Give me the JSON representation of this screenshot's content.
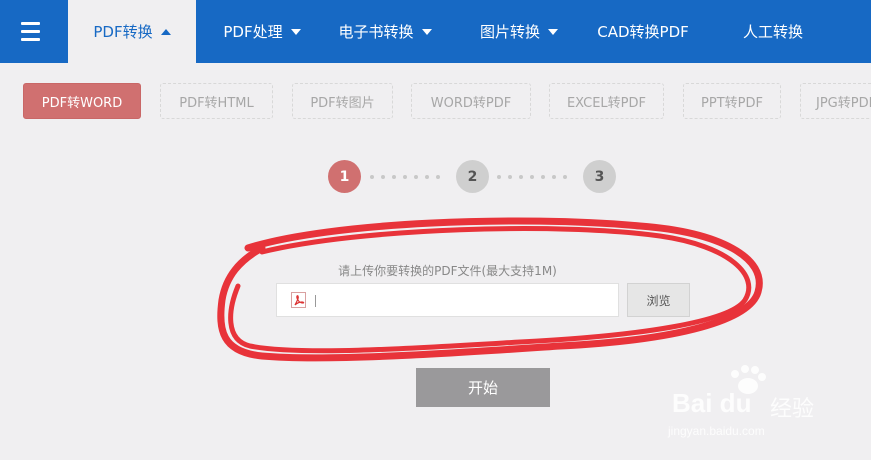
{
  "nav": {
    "tabs": [
      {
        "label": "PDF转换",
        "active": true,
        "caret": "up"
      },
      {
        "label": "PDF处理",
        "caret": "down"
      },
      {
        "label": "电子书转换",
        "caret": "down"
      },
      {
        "label": "图片转换",
        "caret": "down"
      },
      {
        "label": "CAD转换PDF"
      },
      {
        "label": "人工转换"
      }
    ]
  },
  "subtabs": [
    {
      "label": "PDF转WORD",
      "active": true
    },
    {
      "label": "PDF转HTML"
    },
    {
      "label": "PDF转图片"
    },
    {
      "label": "WORD转PDF"
    },
    {
      "label": "EXCEL转PDF"
    },
    {
      "label": "PPT转PDF"
    },
    {
      "label": "JPG转PDF"
    }
  ],
  "steps": [
    "1",
    "2",
    "3"
  ],
  "upload": {
    "hint": "请上传你要转换的PDF文件(最大支持1M)",
    "browse_label": "浏览",
    "file_value": ""
  },
  "start_label": "开始",
  "watermark": {
    "brand": "Bai du",
    "cn": "经验",
    "url": "jingyan.baidu.com"
  },
  "colors": {
    "nav_bg": "#1769c4",
    "accent": "#d07070",
    "annotation": "#e8333a"
  }
}
